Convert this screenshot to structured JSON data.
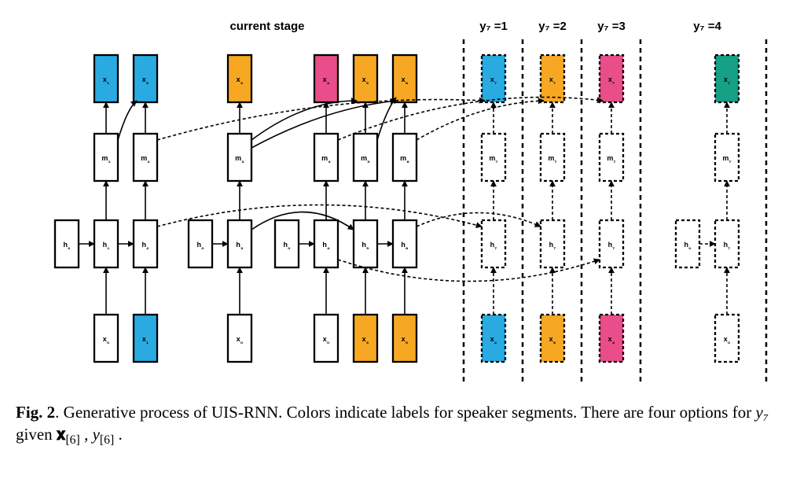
{
  "headers": {
    "current_stage": "current stage",
    "y7_1": "y₇ =1",
    "y7_2": "y₇ =2",
    "y7_3": "y₇ =3",
    "y7_4": "y₇ =4"
  },
  "colors": {
    "blue": "#29abe2",
    "orange": "#f7a823",
    "pink": "#e94e8a",
    "teal": "#16a085",
    "white": "#ffffff",
    "stroke": "#000000"
  },
  "columns": {
    "c1": {
      "x_top": {
        "label": "x₁",
        "color": "blue"
      },
      "m": {
        "label": "m₁"
      },
      "h": {
        "label": "h₁"
      },
      "x_bot": {
        "label": "x₀",
        "color": "white"
      },
      "dashed": false
    },
    "c2": {
      "x_top": {
        "label": "x₂",
        "color": "blue"
      },
      "m": {
        "label": "m₂"
      },
      "h": {
        "label": "h₂"
      },
      "x_bot": {
        "label": "x₁",
        "color": "blue"
      },
      "dashed": false
    },
    "c3": {
      "x_top": {
        "label": "x₃",
        "color": "orange"
      },
      "m": {
        "label": "m₃"
      },
      "h": {
        "label": "h₃"
      },
      "x_bot": {
        "label": "x₀",
        "color": "white"
      },
      "dashed": false
    },
    "c4": {
      "x_top": {
        "label": "x₄",
        "color": "pink"
      },
      "m": {
        "label": "m₄"
      },
      "h": {
        "label": "h₄"
      },
      "x_bot": {
        "label": "x₀",
        "color": "white"
      },
      "dashed": false
    },
    "c5": {
      "x_top": {
        "label": "x₅",
        "color": "orange"
      },
      "m": {
        "label": "m₅"
      },
      "h": {
        "label": "h₅"
      },
      "x_bot": {
        "label": "x₃",
        "color": "orange"
      },
      "dashed": false
    },
    "c6": {
      "x_top": {
        "label": "x₆",
        "color": "orange"
      },
      "m": {
        "label": "m₆"
      },
      "h": {
        "label": "h₆"
      },
      "x_bot": {
        "label": "x₅",
        "color": "orange"
      },
      "dashed": false
    },
    "c7a": {
      "x_top": {
        "label": "x₇",
        "color": "blue"
      },
      "m": {
        "label": "m₇"
      },
      "h": {
        "label": "h₇"
      },
      "x_bot": {
        "label": "x₂",
        "color": "blue"
      },
      "dashed": true
    },
    "c7b": {
      "x_top": {
        "label": "x₇",
        "color": "orange"
      },
      "m": {
        "label": "m₇"
      },
      "h": {
        "label": "h₇"
      },
      "x_bot": {
        "label": "x₆",
        "color": "orange"
      },
      "dashed": true
    },
    "c7c": {
      "x_top": {
        "label": "x₇",
        "color": "pink"
      },
      "m": {
        "label": "m₇"
      },
      "h": {
        "label": "h₇"
      },
      "x_bot": {
        "label": "x₄",
        "color": "pink"
      },
      "dashed": true
    },
    "c7d": {
      "x_top": {
        "label": "x₇",
        "color": "teal"
      },
      "m": {
        "label": "m₇"
      },
      "h": {
        "label": "h₇"
      },
      "x_bot": {
        "label": "x₀",
        "color": "white"
      },
      "dashed": true
    }
  },
  "h0_boxes": {
    "h0a": "h₀",
    "h0b": "h₀",
    "h0c": "h₀",
    "h0d": "h₀"
  },
  "caption": {
    "fig_label": "Fig. 2",
    "text": ". Generative process of UIS-RNN. Colors indicate labels for speaker segments. There are four options for ",
    "y7": "y₇",
    "given": " given ",
    "x6": "𝐱",
    "x6_sub": "[6]",
    "comma": " , ",
    "y6": "y",
    "y6_sub": "[6]",
    "period": " ."
  }
}
